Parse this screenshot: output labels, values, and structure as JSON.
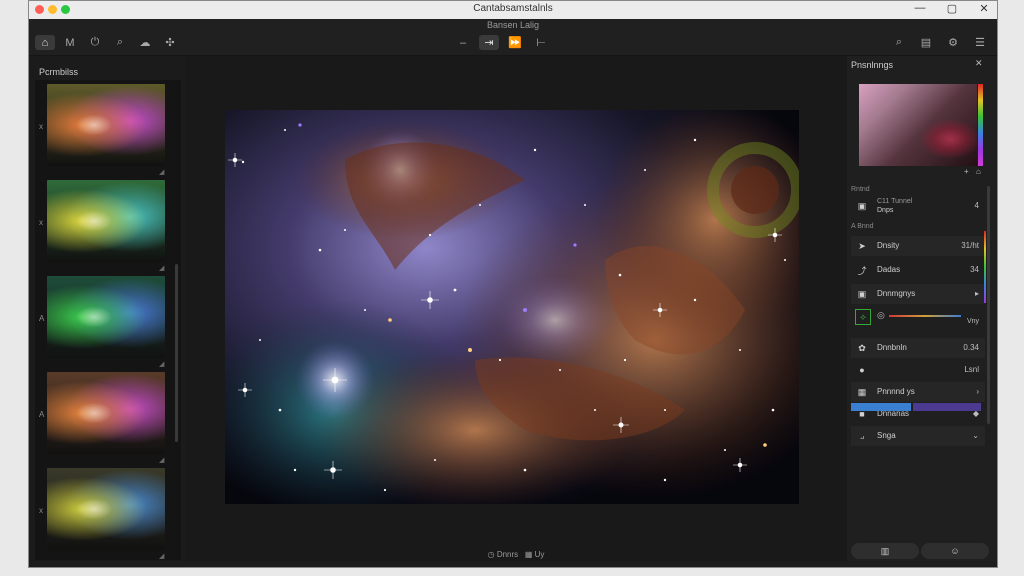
{
  "window": {
    "title": "Cantabsamstalnls",
    "subtitle": "Bansen Lalig"
  },
  "window_controls": {
    "minimize": "—",
    "maximize": "▢",
    "close": "✕"
  },
  "toolbar_left": [
    {
      "name": "home-icon",
      "glyph": "⌂",
      "active": true
    },
    {
      "name": "measure-icon",
      "glyph": "M",
      "active": false
    },
    {
      "name": "power-icon",
      "glyph": "⏻",
      "active": false
    },
    {
      "name": "search-icon",
      "glyph": "⌕",
      "active": false
    },
    {
      "name": "chat-icon",
      "glyph": "☁",
      "active": false
    },
    {
      "name": "tools-icon",
      "glyph": "✣",
      "active": false
    }
  ],
  "toolbar_center": [
    {
      "name": "dash-icon",
      "glyph": "–",
      "active": false
    },
    {
      "name": "arrow-icon",
      "glyph": "⇥",
      "active": true
    },
    {
      "name": "forward-icon",
      "glyph": "⏩",
      "active": false
    },
    {
      "name": "tick-icon",
      "glyph": "⊢",
      "active": false
    }
  ],
  "toolbar_right": [
    {
      "name": "search-icon-right",
      "glyph": "⌕"
    },
    {
      "name": "note-icon",
      "glyph": "▤"
    },
    {
      "name": "settings-icon",
      "glyph": "⚙"
    },
    {
      "name": "menu-icon",
      "glyph": "☰"
    }
  ],
  "left_panel": {
    "title": "Pcrmbilss",
    "thumbnails": [
      {
        "mark": "x",
        "colors": [
          "#e07a3a",
          "#c74bd0",
          "#5e5a2a"
        ]
      },
      {
        "mark": "x",
        "colors": [
          "#d9d23a",
          "#49c4c4",
          "#2f6b3a"
        ]
      },
      {
        "mark": "A",
        "colors": [
          "#3ac94a",
          "#4a7ad9",
          "#1e4d3a"
        ]
      },
      {
        "mark": "A",
        "colors": [
          "#e0803a",
          "#c54dc9",
          "#5a3b2a"
        ]
      },
      {
        "mark": "x",
        "colors": [
          "#c9c83a",
          "#4a8ad0",
          "#3a3a2a"
        ]
      }
    ]
  },
  "right_panel": {
    "title": "Pnsnlnngs",
    "section_1": "Rntnd",
    "item_1": {
      "label": "C11 Tunnel",
      "sublabel": "Dnps",
      "value": "4"
    },
    "section_2": "A Bnnd",
    "rows": [
      {
        "icon": "arrow-icon",
        "glyph": "➤",
        "label": "Dnsity",
        "value": "31/ht"
      },
      {
        "icon": "cursor-icon",
        "glyph": "⤴",
        "label": "Dadas",
        "value": "34"
      },
      {
        "icon": "image-icon",
        "glyph": "▣",
        "label": "Dnnmgnys",
        "value": "▸"
      }
    ],
    "slider_label": "Vny",
    "rows_2": [
      {
        "icon": "palette-icon",
        "glyph": "✿",
        "label": "Dnnbnln",
        "value": "0.34"
      },
      {
        "icon": "circle-icon",
        "glyph": "●",
        "label": "",
        "value": "Lsnl"
      },
      {
        "icon": "photo-icon",
        "glyph": "▦",
        "label": "Pnnnnd ys",
        "value": "›"
      },
      {
        "icon": "square-icon",
        "glyph": "■",
        "label": "Dnnanas",
        "value": "◆"
      },
      {
        "icon": "layer-icon",
        "glyph": "⟓",
        "label": "Snga",
        "value": "⌄"
      }
    ],
    "bottom_tabs": [
      {
        "name": "layout-tab",
        "glyph": "▥"
      },
      {
        "name": "emoji-tab",
        "glyph": "☺"
      }
    ]
  },
  "status": {
    "left_icon": "◷",
    "text": "Dnnrs",
    "right_icon": "▦",
    "right_text": "Uy"
  },
  "colors": {
    "accent_blue": "#3a7fd2",
    "accent_purple": "#5a3b9a",
    "panel": "#1f1f1f"
  }
}
